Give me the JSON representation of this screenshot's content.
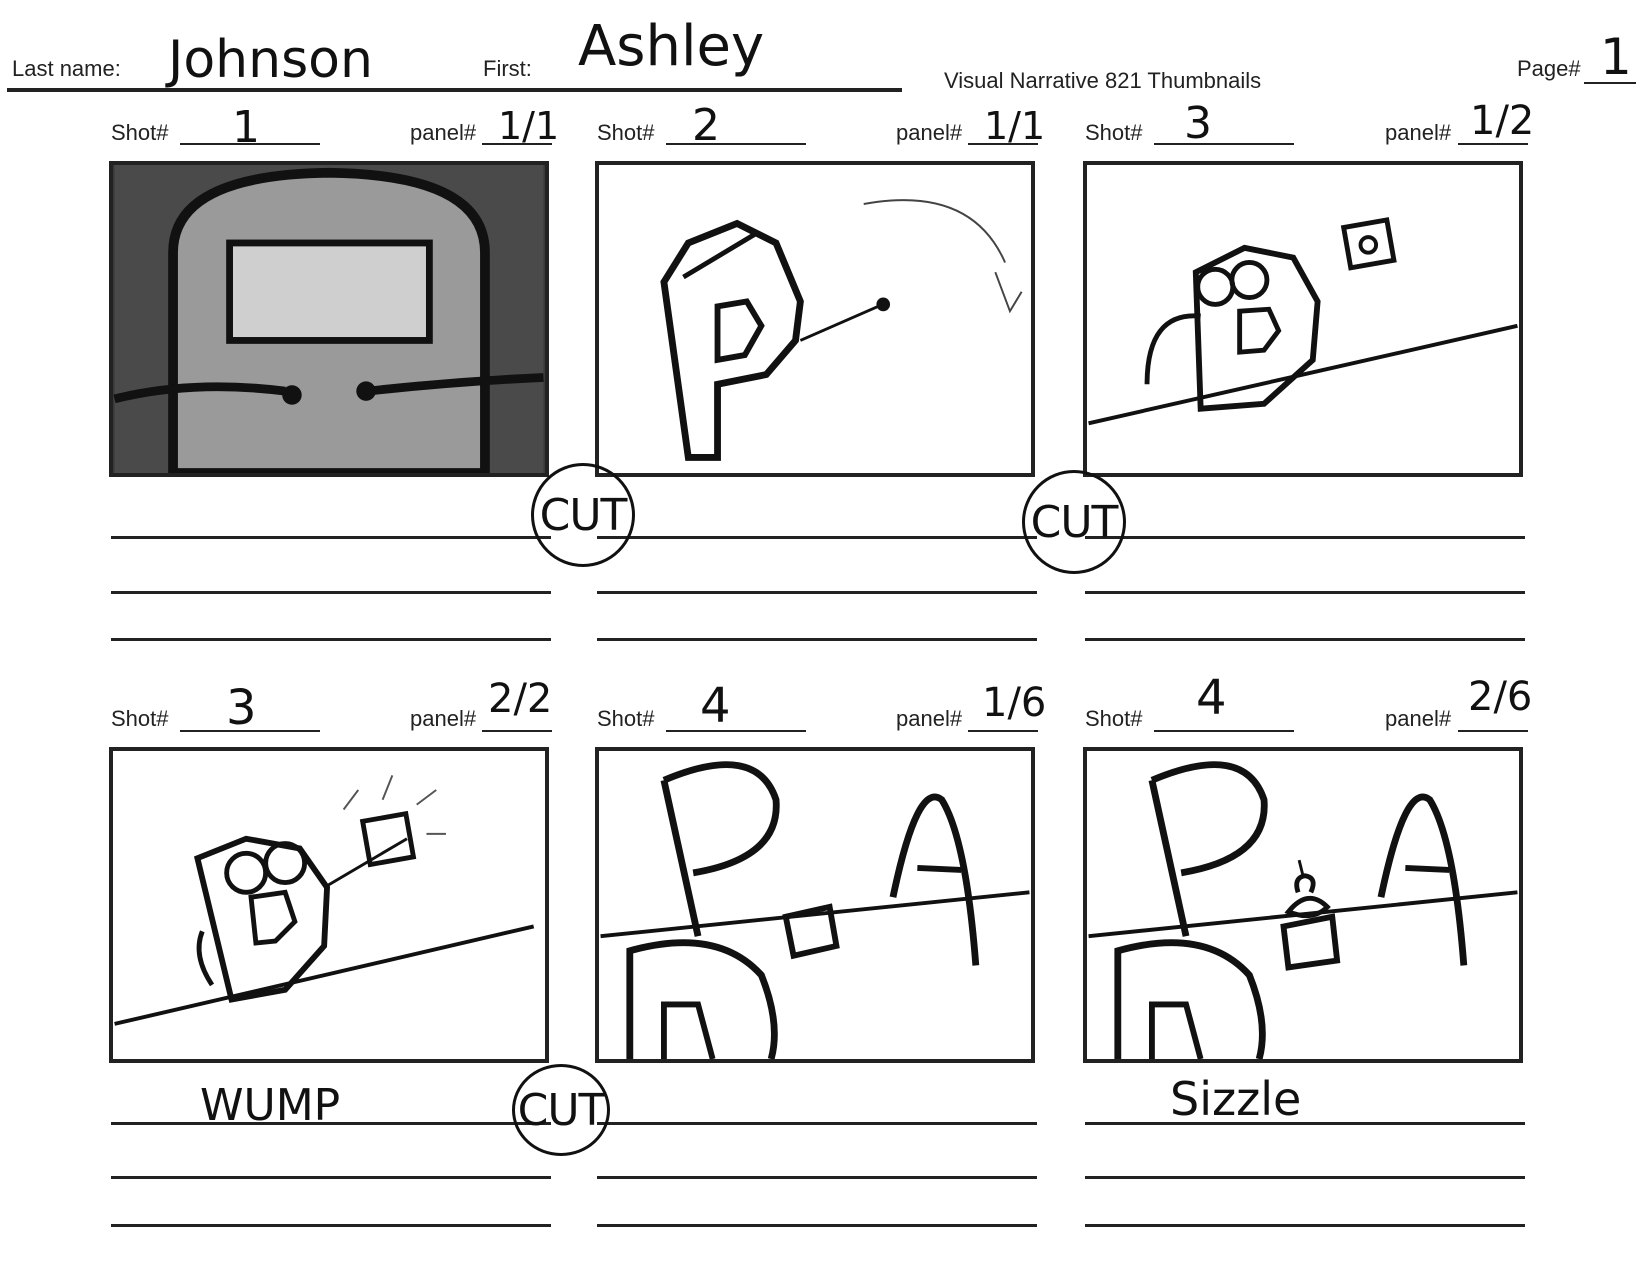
{
  "header": {
    "last_name_label": "Last name:",
    "last_name_value": "Johnson",
    "first_label": "First:",
    "first_value": "Ashley",
    "course_title": "Visual Narrative 821 Thumbnails",
    "page_label": "Page#",
    "page_value": "1"
  },
  "shot_label": "Shot#",
  "panel_label": "panel#",
  "frames": [
    {
      "shot": "1",
      "panel": "1/1"
    },
    {
      "shot": "2",
      "panel": "1/1"
    },
    {
      "shot": "3",
      "panel": "1/2"
    },
    {
      "shot": "3",
      "panel": "2/2"
    },
    {
      "shot": "4",
      "panel": "1/6"
    },
    {
      "shot": "4",
      "panel": "2/6"
    }
  ],
  "transitions": {
    "cut_1": "CUT",
    "cut_2": "CUT",
    "cut_3": "CUT"
  },
  "notes": {
    "frame_4": "WUMP",
    "frame_6": "Sizzle"
  }
}
